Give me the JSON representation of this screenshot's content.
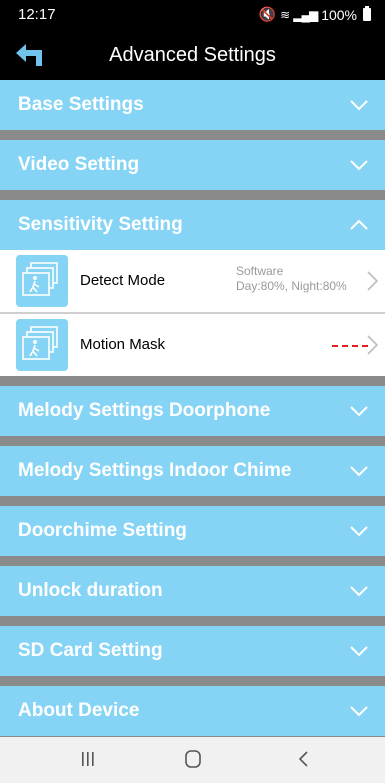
{
  "status_bar": {
    "time": "12:17",
    "battery": "100%"
  },
  "header": {
    "title": "Advanced Settings"
  },
  "sections_top": [
    {
      "label": "Base Settings"
    },
    {
      "label": "Video Setting"
    }
  ],
  "open_section": {
    "label": "Sensitivity Setting",
    "items": [
      {
        "name": "Detect Mode",
        "value_line1": "Software",
        "value_line2": "Day:80%, Night:80%"
      },
      {
        "name": "Motion Mask"
      }
    ]
  },
  "sections_bottom": [
    {
      "label": "Melody Settings Doorphone"
    },
    {
      "label": "Melody Settings Indoor Chime"
    },
    {
      "label": "Doorchime Setting"
    },
    {
      "label": "Unlock duration"
    },
    {
      "label": "SD Card Setting"
    },
    {
      "label": "About Device"
    }
  ],
  "colors": {
    "section_bg": "#86d4f5",
    "separator": "#8a8a8a",
    "header_bg": "#000000",
    "annotation": "#e0201e"
  }
}
